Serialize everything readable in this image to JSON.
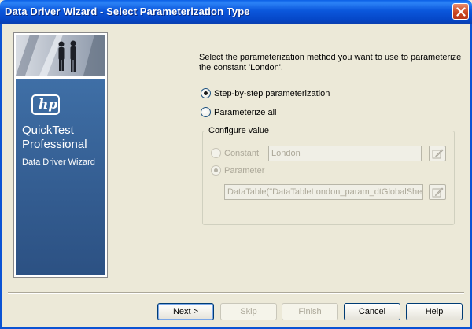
{
  "window": {
    "title": "Data Driver Wizard - Select Parameterization Type"
  },
  "side_panel": {
    "logo": "hp",
    "product_name": "QuickTest Professional",
    "wizard_name": "Data Driver Wizard"
  },
  "instructions": "Select the parameterization method you want to use to parameterize the constant 'London'.",
  "options": {
    "step_by_step": {
      "label": "Step-by-step parameterization",
      "selected": true
    },
    "parameterize_all": {
      "label": "Parameterize all",
      "selected": false
    }
  },
  "configure_value": {
    "title": "Configure value",
    "constant": {
      "label": "Constant",
      "value": "London",
      "selected": false,
      "enabled": false
    },
    "parameter": {
      "label": "Parameter",
      "value": "DataTable(\"DataTableLondon_param_dtGlobalShe",
      "selected": true,
      "enabled": false
    }
  },
  "buttons": {
    "next": "Next >",
    "skip": "Skip",
    "finish": "Finish",
    "cancel": "Cancel",
    "help": "Help"
  },
  "colors": {
    "titlebar": "#0b57dc",
    "side_blue": "#335c90",
    "dialog_bg": "#ece9d8",
    "disabled_text": "#aca899"
  }
}
